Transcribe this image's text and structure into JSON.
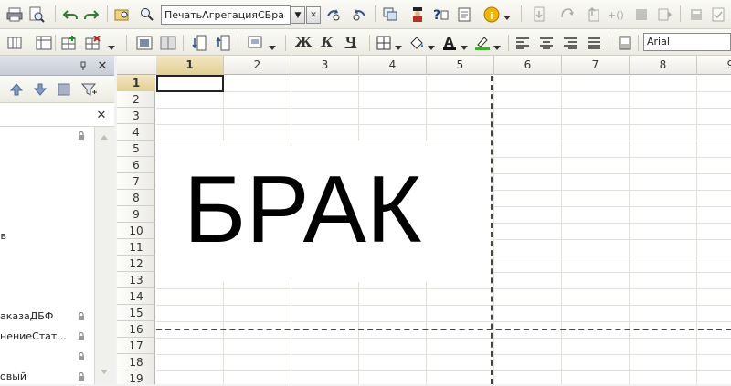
{
  "toolbar": {
    "template_combo_value": "ПечатьАгрегацияСБра",
    "font_combo_value": "Arial",
    "bold_label": "Ж",
    "italic_label": "К",
    "underline_label": "Ч"
  },
  "left_panel": {
    "items": [
      {
        "text": "",
        "locked": true
      },
      {
        "text": "в",
        "locked": false
      },
      {
        "text": "аказаДБФ",
        "locked": true
      },
      {
        "text": "нениеСтат...",
        "locked": true
      },
      {
        "text": "",
        "locked": true
      },
      {
        "text": "овый",
        "locked": true
      }
    ]
  },
  "sheet": {
    "columns": [
      "1",
      "2",
      "3",
      "4",
      "5",
      "6",
      "7",
      "8",
      "9"
    ],
    "rows": [
      "1",
      "2",
      "3",
      "4",
      "5",
      "6",
      "7",
      "8",
      "9",
      "10",
      "11",
      "12",
      "13",
      "14",
      "15",
      "16",
      "17",
      "18",
      "19"
    ],
    "selected_column": "1",
    "selected_row": "1",
    "content_text": "БРАК"
  },
  "colors": {
    "toolbar_bg": "#ecebe3",
    "selected_header": "#e3cf91",
    "grid_line": "#e1e1dc",
    "page_break": "#444444"
  }
}
